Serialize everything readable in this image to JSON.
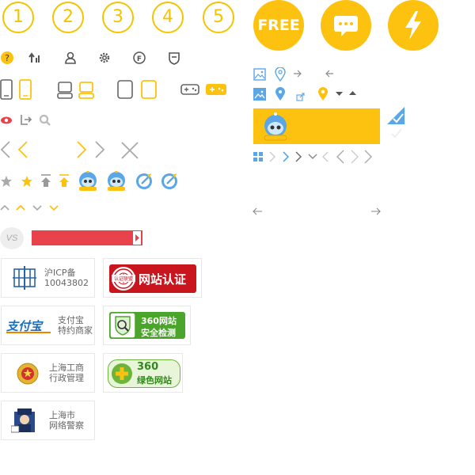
{
  "numbers": [
    "1",
    "2",
    "3",
    "4",
    "5"
  ],
  "free_badge": {
    "label": "FREE"
  },
  "vs_label": "VS",
  "badges": {
    "icp": {
      "line1": "沪ICP备",
      "line2": "10043802"
    },
    "site_auth": {
      "label": "网站认证",
      "seal": "认证联盟"
    },
    "alipay": {
      "logo": "支付宝",
      "line1": "支付宝",
      "line2": "特约商家"
    },
    "secure360": {
      "line1": "360网站",
      "line2": "安全检测"
    },
    "shanghai_ic": {
      "line1": "上海工商",
      "line2": "行政管理"
    },
    "green360": {
      "line1": "360",
      "line2": "绿色网站"
    },
    "police": {
      "line1": "上海市",
      "line2": "网络警察"
    }
  },
  "colors": {
    "yellow": "#fdc20f",
    "gold": "#f5c400",
    "blue": "#5aa6e6",
    "red": "#e8434b",
    "gray": "#999999"
  },
  "icons": [
    "question-icon",
    "sort-icon",
    "user-icon",
    "gear-icon",
    "f-icon",
    "shield-icon",
    "phone-icon",
    "computer-icon",
    "tablet-icon",
    "gamepad-icon",
    "eye-icon",
    "export-icon",
    "search-icon",
    "chevron-left-icon",
    "chevron-right-icon",
    "close-icon",
    "star-icon",
    "top-icon",
    "robot-icon",
    "edit-icon",
    "arrow-up-icon",
    "arrow-down-icon",
    "image-icon",
    "location-icon",
    "arrow-right-icon",
    "arrow-left-icon",
    "chat-icon",
    "lightning-icon",
    "check-icon",
    "grid-icon"
  ]
}
